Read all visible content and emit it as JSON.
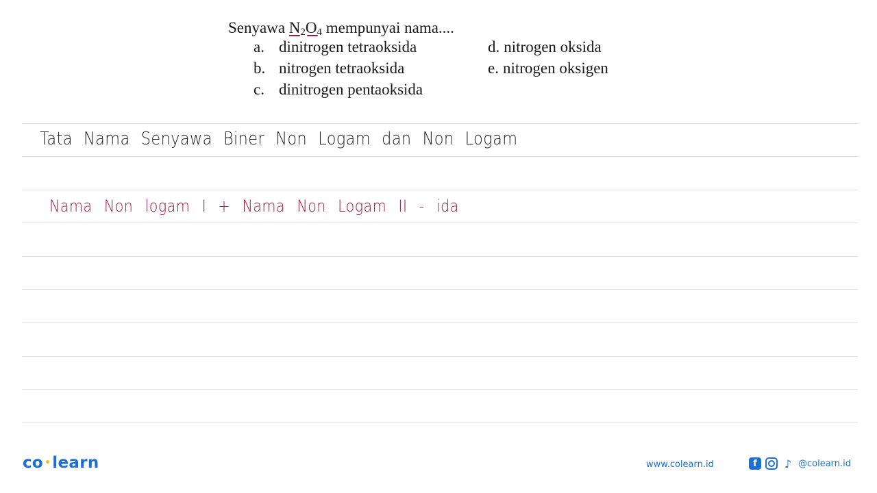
{
  "question": {
    "prefix": "Senyawa ",
    "formula": {
      "el1": "N",
      "sub1": "2",
      "el2": "O",
      "sub2": "4"
    },
    "suffix": " mempunyai nama....",
    "options": [
      {
        "letter": "a.",
        "text": "dinitrogen tetraoksida"
      },
      {
        "letter": "b.",
        "text": "nitrogen tetraoksida"
      },
      {
        "letter": "c.",
        "text": "dinitrogen pentaoksida"
      },
      {
        "letter": "d.",
        "text": "nitrogen oksida"
      },
      {
        "letter": "e.",
        "text": "nitrogen oksigen"
      }
    ]
  },
  "notes": {
    "line1": "Tata Nama Senyawa Biner Non Logam dan Non Logam",
    "line2": "Nama Non logam I + Nama Non Logam II - ida"
  },
  "colors": {
    "handwriting_red": "#a0173e",
    "brand_blue": "#1d6fd1",
    "brand_yellow": "#f5c400"
  },
  "footer": {
    "logo_left": "co",
    "logo_dot": "•",
    "logo_right": "learn",
    "website": "www.colearn.id",
    "facebook_glyph": "f",
    "tiktok_glyph": "♪",
    "handle": "@colearn.id"
  }
}
